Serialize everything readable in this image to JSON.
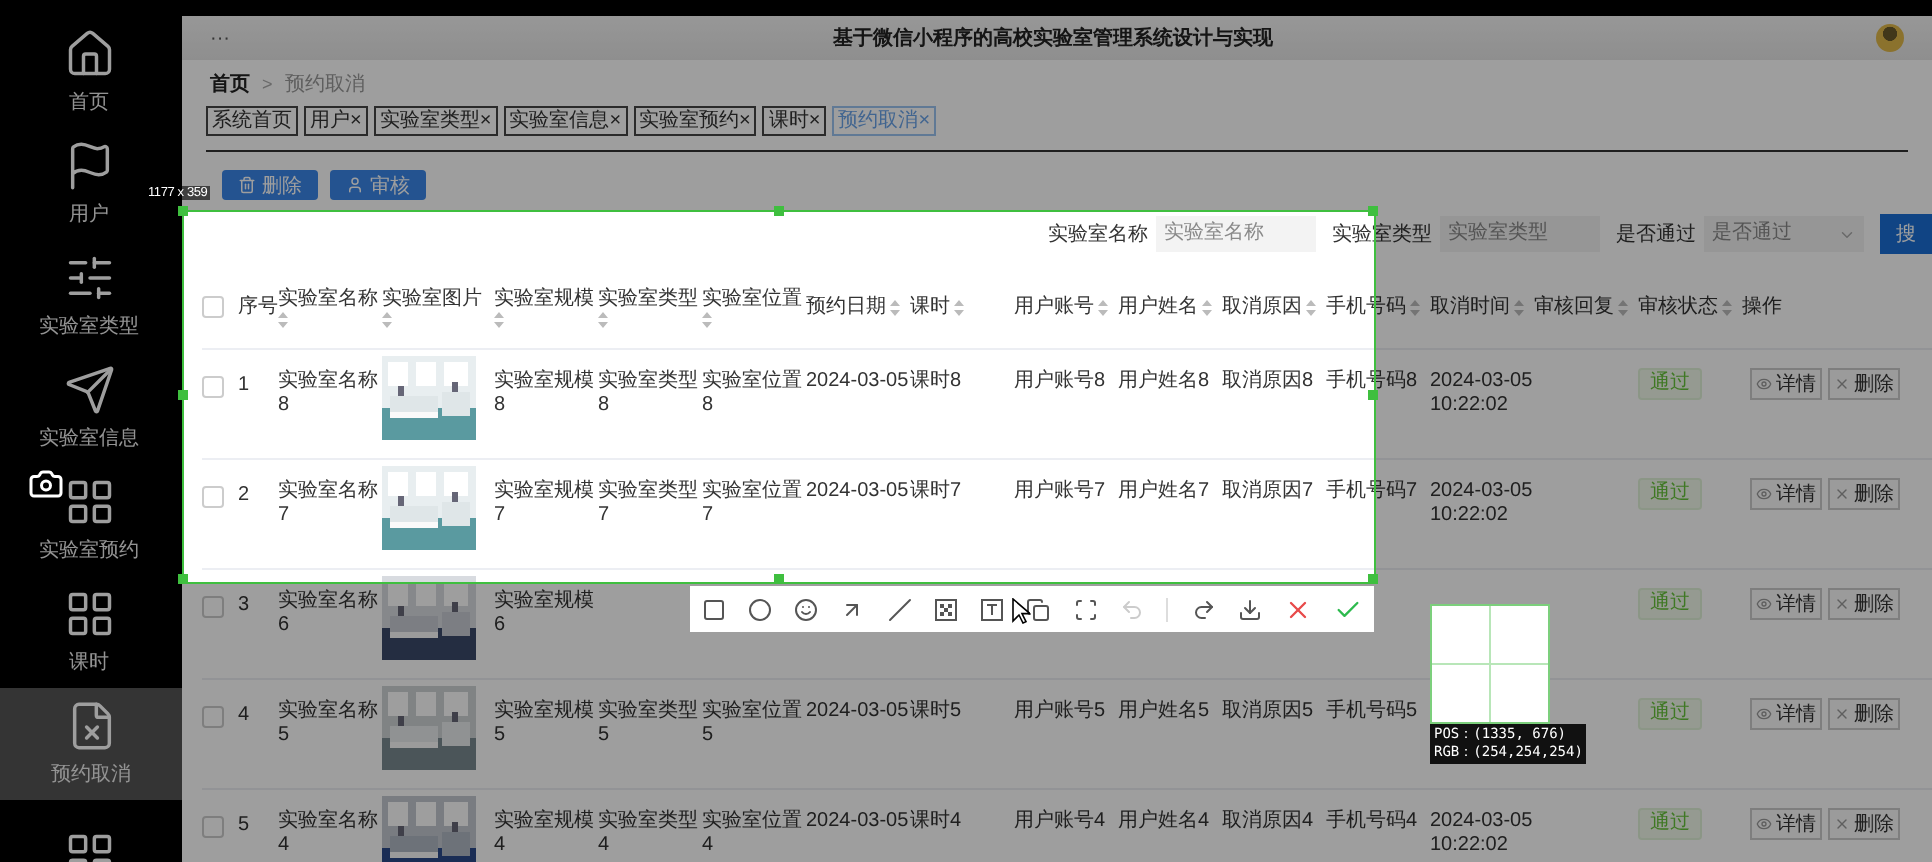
{
  "sidebar": {
    "items": [
      {
        "label": "首页",
        "selected": false
      },
      {
        "label": "用户",
        "selected": false
      },
      {
        "label": "实验室类型",
        "selected": false
      },
      {
        "label": "实验室信息",
        "selected": false
      },
      {
        "label": "实验室预约",
        "selected": false
      },
      {
        "label": "课时",
        "selected": false
      },
      {
        "label": "预约取消",
        "selected": true
      },
      {
        "selected": false
      }
    ]
  },
  "header": {
    "menu_mark": "···",
    "title": "基于微信小程序的高校实验室管理系统设计与实现"
  },
  "breadcrumb": {
    "separator": ">",
    "items": [
      {
        "label": "首页",
        "current": false
      },
      {
        "label": "预约取消",
        "current": true
      }
    ]
  },
  "tabs": [
    {
      "label": "系统首页",
      "selected": false
    },
    {
      "label": "用户",
      "close_mark": "×",
      "selected": false
    },
    {
      "label": "实验室类型",
      "close_mark": "×",
      "selected": false
    },
    {
      "label": "实验室信息",
      "close_mark": "×",
      "selected": false
    },
    {
      "label": "实验室预约",
      "close_mark": "×",
      "selected": false
    },
    {
      "label": "课时",
      "close_mark": "×",
      "selected": false
    },
    {
      "label": "预约取消",
      "close_mark": "×",
      "selected": true
    }
  ],
  "toolbar_buttons": [
    {
      "label": "删除",
      "kind": "delete"
    },
    {
      "label": "审核",
      "kind": "review"
    }
  ],
  "search": {
    "fields": [
      {
        "label": "实验室名称",
        "placeholder": "实验室名称",
        "kind": "text"
      },
      {
        "label": "实验室类型",
        "placeholder": "实验室类型",
        "kind": "text"
      },
      {
        "label": "是否通过",
        "placeholder": "是否通过",
        "kind": "select"
      }
    ],
    "button": "搜"
  },
  "table": {
    "select_all": {
      "checked": false
    },
    "columns": [
      {
        "label": "序号",
        "sortable": false
      },
      {
        "label": "实验室名称",
        "sortable": true
      },
      {
        "label": "实验室图片",
        "sortable": true
      },
      {
        "label": "实验室规模",
        "sortable": true
      },
      {
        "label": "实验室类型",
        "sortable": true
      },
      {
        "label": "实验室位置",
        "sortable": true
      },
      {
        "label": "预约日期",
        "sortable": true
      },
      {
        "label": "课时",
        "sortable": true
      },
      {
        "label": "用户账号",
        "sortable": true
      },
      {
        "label": "用户姓名",
        "sortable": true
      },
      {
        "label": "取消原因",
        "sortable": true
      },
      {
        "label": "手机号码",
        "sortable": true
      },
      {
        "label": "取消时间",
        "sortable": true
      },
      {
        "label": "审核回复",
        "sortable": true
      },
      {
        "label": "审核状态",
        "sortable": true
      },
      {
        "label": "操作",
        "sortable": false
      }
    ],
    "rows": [
      {
        "checked": false,
        "index": "1",
        "lab_name": "实验室名称8",
        "lab_scale": "实验室规模8",
        "lab_type": "实验室类型8",
        "lab_location": "实验室位置8",
        "booking_date": "2024-03-05",
        "lesson": "课时8",
        "user_account": "用户账号8",
        "user_name": "用户姓名8",
        "cancel_reason": "取消原因8",
        "phone": "手机号码8",
        "cancel_time": "2024-03-05 10:22:02",
        "review_status": {
          "label": "通过",
          "kind": "approved"
        },
        "actions": [
          {
            "label": "详情",
            "kind": "view"
          },
          {
            "label": "删除",
            "kind": "delete"
          }
        ]
      },
      {
        "checked": false,
        "index": "2",
        "lab_name": "实验室名称7",
        "lab_scale": "实验室规模7",
        "lab_type": "实验室类型7",
        "lab_location": "实验室位置7",
        "booking_date": "2024-03-05",
        "lesson": "课时7",
        "user_account": "用户账号7",
        "user_name": "用户姓名7",
        "cancel_reason": "取消原因7",
        "phone": "手机号码7",
        "cancel_time": "2024-03-05 10:22:02",
        "review_status": {
          "label": "通过",
          "kind": "approved"
        },
        "actions": [
          {
            "label": "详情",
            "kind": "view"
          },
          {
            "label": "删除",
            "kind": "delete"
          }
        ]
      },
      {
        "checked": false,
        "index": "3",
        "lab_name": "实验室名称6",
        "lab_scale": "实验室规模6",
        "review_status": {
          "label": "通过",
          "kind": "approved"
        },
        "actions": [
          {
            "label": "详情",
            "kind": "view"
          },
          {
            "label": "删除",
            "kind": "delete"
          }
        ]
      },
      {
        "checked": false,
        "index": "4",
        "lab_name": "实验室名称5",
        "lab_scale": "实验室规模5",
        "lab_type": "实验室类型5",
        "lab_location": "实验室位置5",
        "booking_date": "2024-03-05",
        "lesson": "课时5",
        "user_account": "用户账号5",
        "user_name": "用户姓名5",
        "cancel_reason": "取消原因5",
        "phone": "手机号码5",
        "review_status": {
          "label": "通过",
          "kind": "approved"
        },
        "actions": [
          {
            "label": "详情",
            "kind": "view"
          },
          {
            "label": "删除",
            "kind": "delete"
          }
        ]
      },
      {
        "checked": false,
        "index": "5",
        "lab_name": "实验室名称4",
        "lab_scale": "实验室规模4",
        "lab_type": "实验室类型4",
        "lab_location": "实验室位置4",
        "booking_date": "2024-03-05",
        "lesson": "课时4",
        "user_account": "用户账号4",
        "user_name": "用户姓名4",
        "cancel_reason": "取消原因4",
        "phone": "手机号码4",
        "cancel_time": "2024-03-05 10:22:02",
        "review_status": {
          "label": "通过",
          "kind": "approved"
        },
        "actions": [
          {
            "label": "详情",
            "kind": "view"
          },
          {
            "label": "删除",
            "kind": "delete"
          }
        ]
      }
    ]
  },
  "capture": {
    "size_label": "1177 x 359",
    "tools": [
      {
        "kind": "rectangle",
        "disabled": false
      },
      {
        "kind": "ellipse",
        "disabled": false
      },
      {
        "kind": "emoji",
        "disabled": false
      },
      {
        "kind": "arrow",
        "disabled": false
      },
      {
        "kind": "line",
        "disabled": false
      },
      {
        "kind": "mosaic",
        "disabled": false
      },
      {
        "kind": "text",
        "disabled": false
      },
      {
        "kind": "pin",
        "disabled": false
      },
      {
        "kind": "scan",
        "disabled": false
      },
      {
        "kind": "undo",
        "disabled": true
      },
      {
        "kind": "divider"
      },
      {
        "kind": "redo",
        "disabled": false
      },
      {
        "kind": "save",
        "disabled": false
      },
      {
        "kind": "cancel",
        "disabled": false
      },
      {
        "kind": "confirm",
        "disabled": false
      }
    ],
    "magnifier": {
      "pos": "POS：(1335, 676)",
      "rgb": "RGB：(254,254,254)"
    }
  }
}
